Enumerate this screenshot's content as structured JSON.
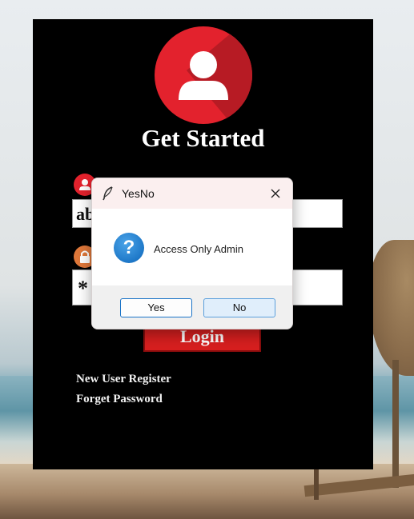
{
  "login": {
    "title": "Get Started",
    "username_value": "ab",
    "password_value": "*",
    "login_button": "Login",
    "register_link": "New User Register",
    "forget_link": "Forget Password",
    "icons": [
      "user-avatar-icon",
      "user-icon",
      "lock-icon"
    ],
    "accent_color": "#e3222d"
  },
  "dialog": {
    "title": "YesNo",
    "message": "Access Only Admin",
    "icon": "question-icon",
    "yes_label": "Yes",
    "no_label": "No",
    "close_icon": "close-icon"
  }
}
